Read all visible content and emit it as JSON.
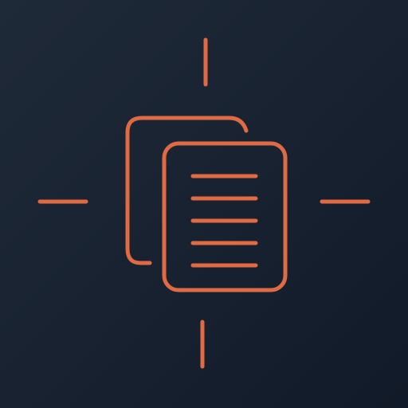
{
  "icon": {
    "name": "copy-document-icon",
    "accent_color": "#E06A43",
    "background_top_left": "#1F2A38",
    "background_bottom_right": "#111A28",
    "document_line_count": 5
  }
}
